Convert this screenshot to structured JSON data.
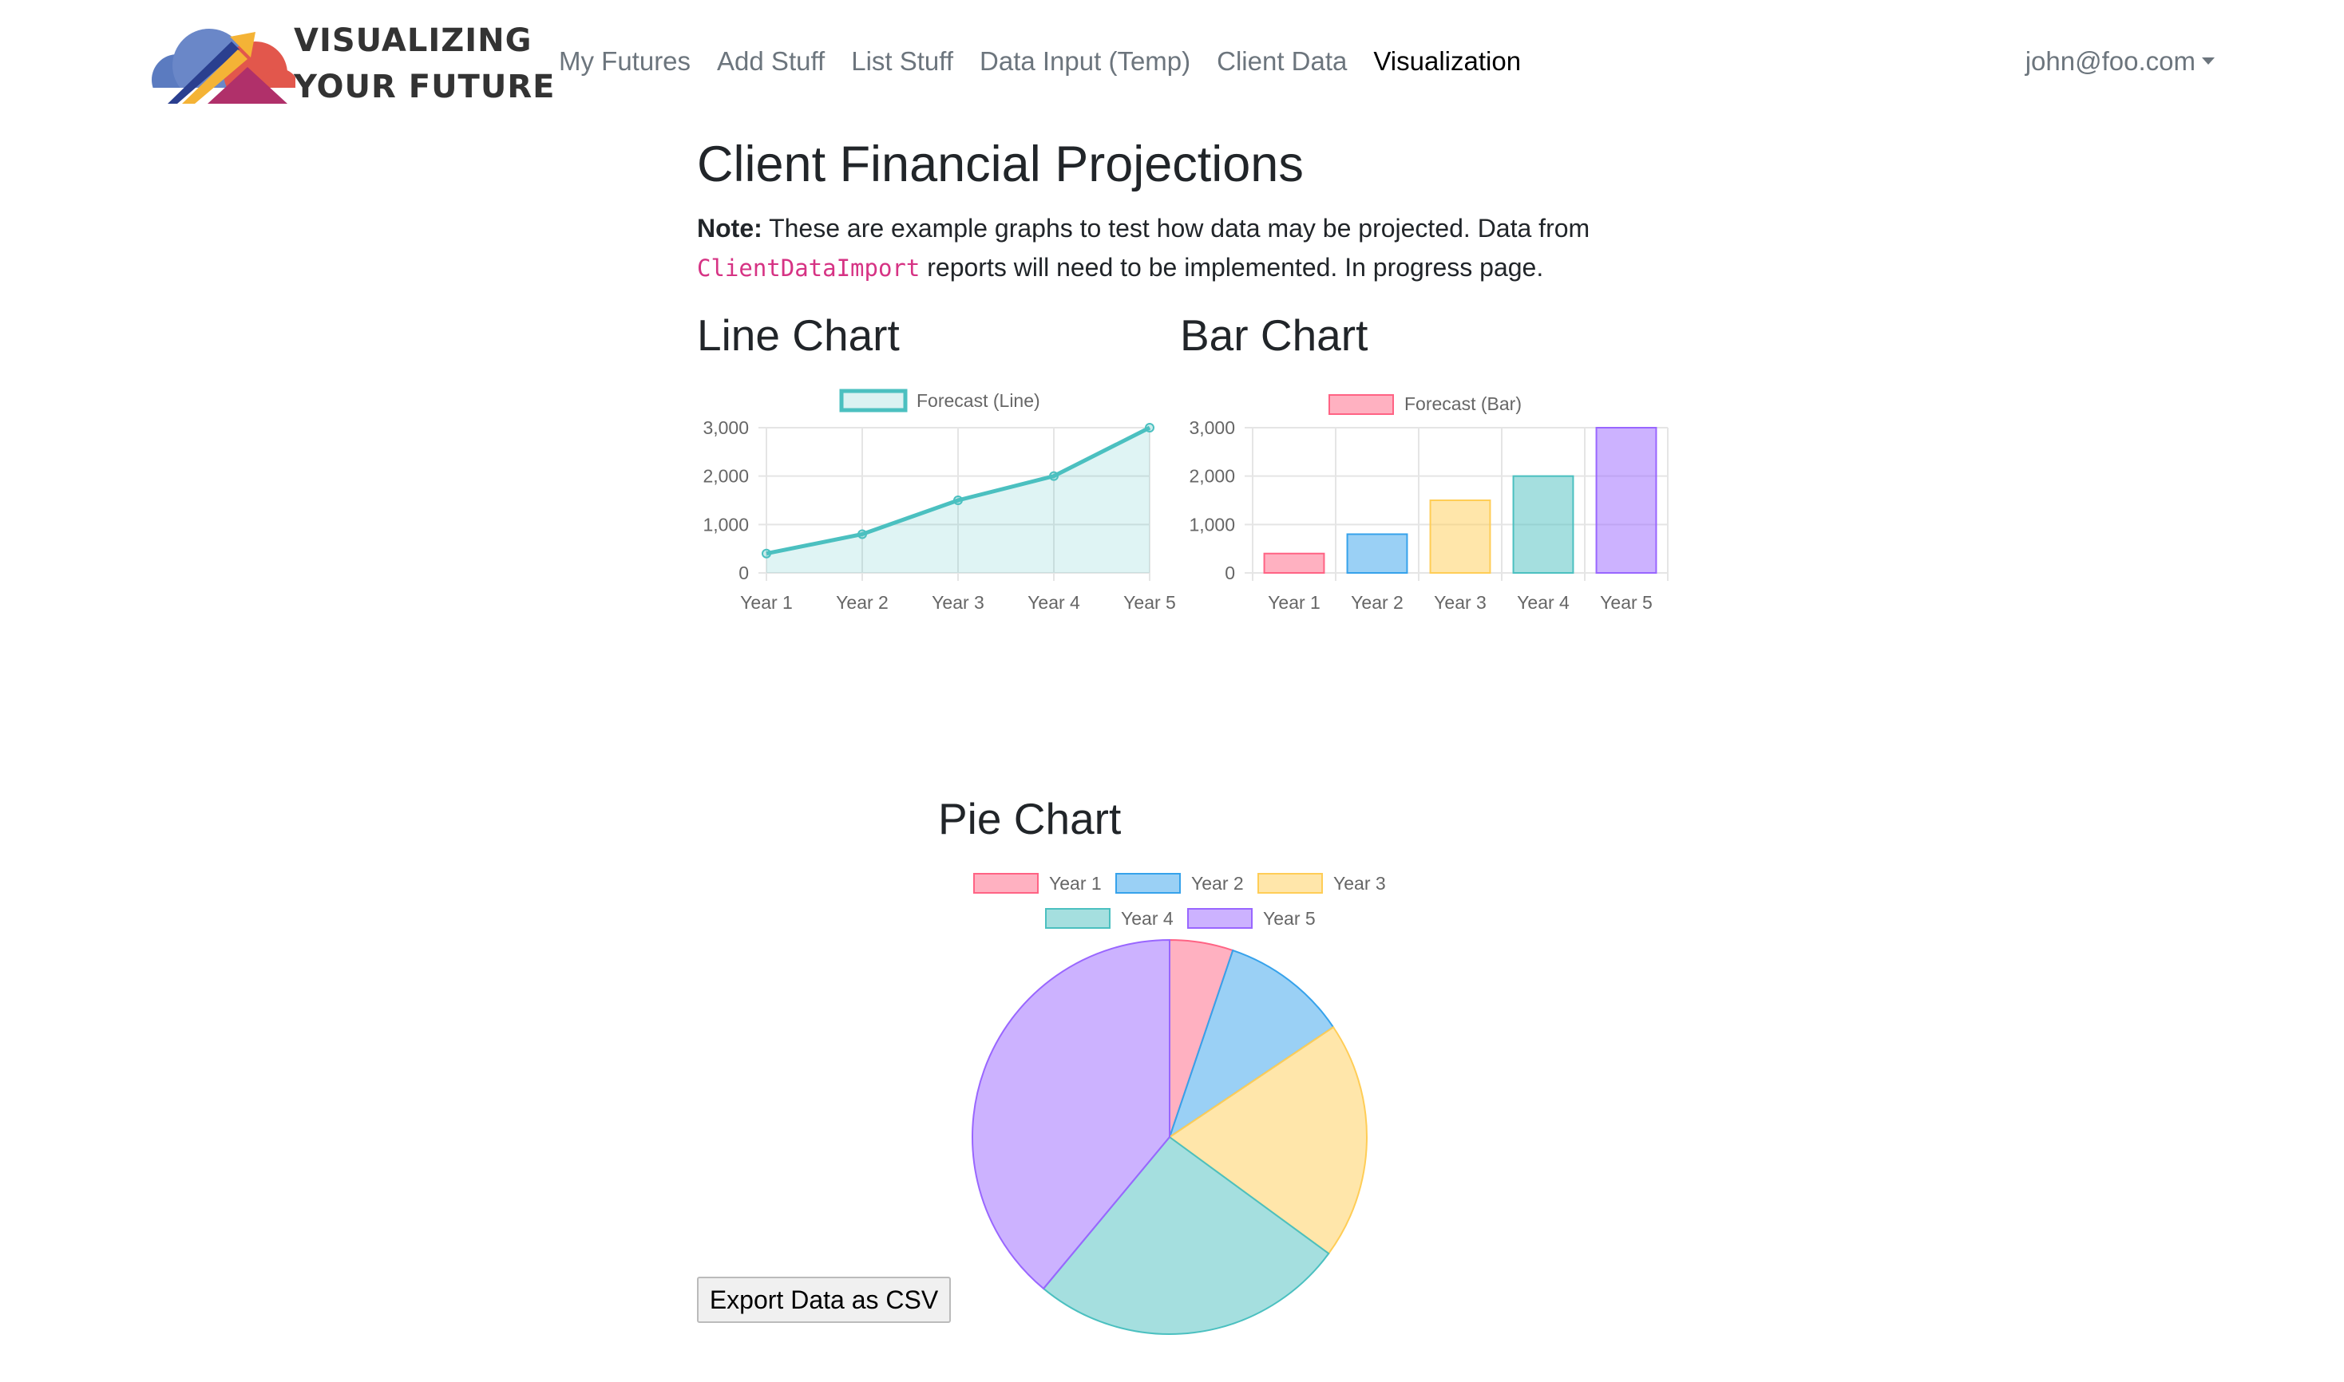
{
  "brand": {
    "line1": "VISUALIZING",
    "line2": "YOUR FUTURE"
  },
  "nav": {
    "links": [
      {
        "label": "My Futures"
      },
      {
        "label": "Add Stuff"
      },
      {
        "label": "List Stuff"
      },
      {
        "label": "Data Input (Temp)"
      },
      {
        "label": "Client Data"
      },
      {
        "label": "Visualization"
      }
    ],
    "active": "Visualization",
    "user": "john@foo.com"
  },
  "page": {
    "title": "Client Financial Projections",
    "note_bold": "Note:",
    "note_text1": " These are example graphs to test how data may be projected. Data from ",
    "note_code": "ClientDataImport",
    "note_text2": " reports will need to be implemented. In progress page."
  },
  "colors": {
    "year1": "#ff6384",
    "year2": "#36a2eb",
    "year3": "#ffcd56",
    "year4": "#4bc0c0",
    "year5": "#9966ff",
    "line": "#4bc0c0"
  },
  "chart_data": [
    {
      "type": "line",
      "title": "Line Chart",
      "categories": [
        "Year 1",
        "Year 2",
        "Year 3",
        "Year 4",
        "Year 5"
      ],
      "series": [
        {
          "name": "Forecast (Line)",
          "values": [
            400,
            800,
            1500,
            2000,
            3000
          ]
        }
      ],
      "ylim": [
        0,
        3000
      ],
      "yticks": [
        "0",
        "1,000",
        "2,000",
        "3,000"
      ],
      "grid": true,
      "legend": "top"
    },
    {
      "type": "bar",
      "title": "Bar Chart",
      "categories": [
        "Year 1",
        "Year 2",
        "Year 3",
        "Year 4",
        "Year 5"
      ],
      "series": [
        {
          "name": "Forecast (Bar)",
          "values": [
            400,
            800,
            1500,
            2000,
            3000
          ]
        }
      ],
      "ylim": [
        0,
        3000
      ],
      "yticks": [
        "0",
        "1,000",
        "2,000",
        "3,000"
      ],
      "grid": true,
      "legend": "top"
    },
    {
      "type": "pie",
      "title": "Pie Chart",
      "categories": [
        "Year 1",
        "Year 2",
        "Year 3",
        "Year 4",
        "Year 5"
      ],
      "values": [
        400,
        800,
        1500,
        2000,
        3000
      ],
      "legend": "top"
    }
  ],
  "export": {
    "label": "Export Data as CSV"
  }
}
